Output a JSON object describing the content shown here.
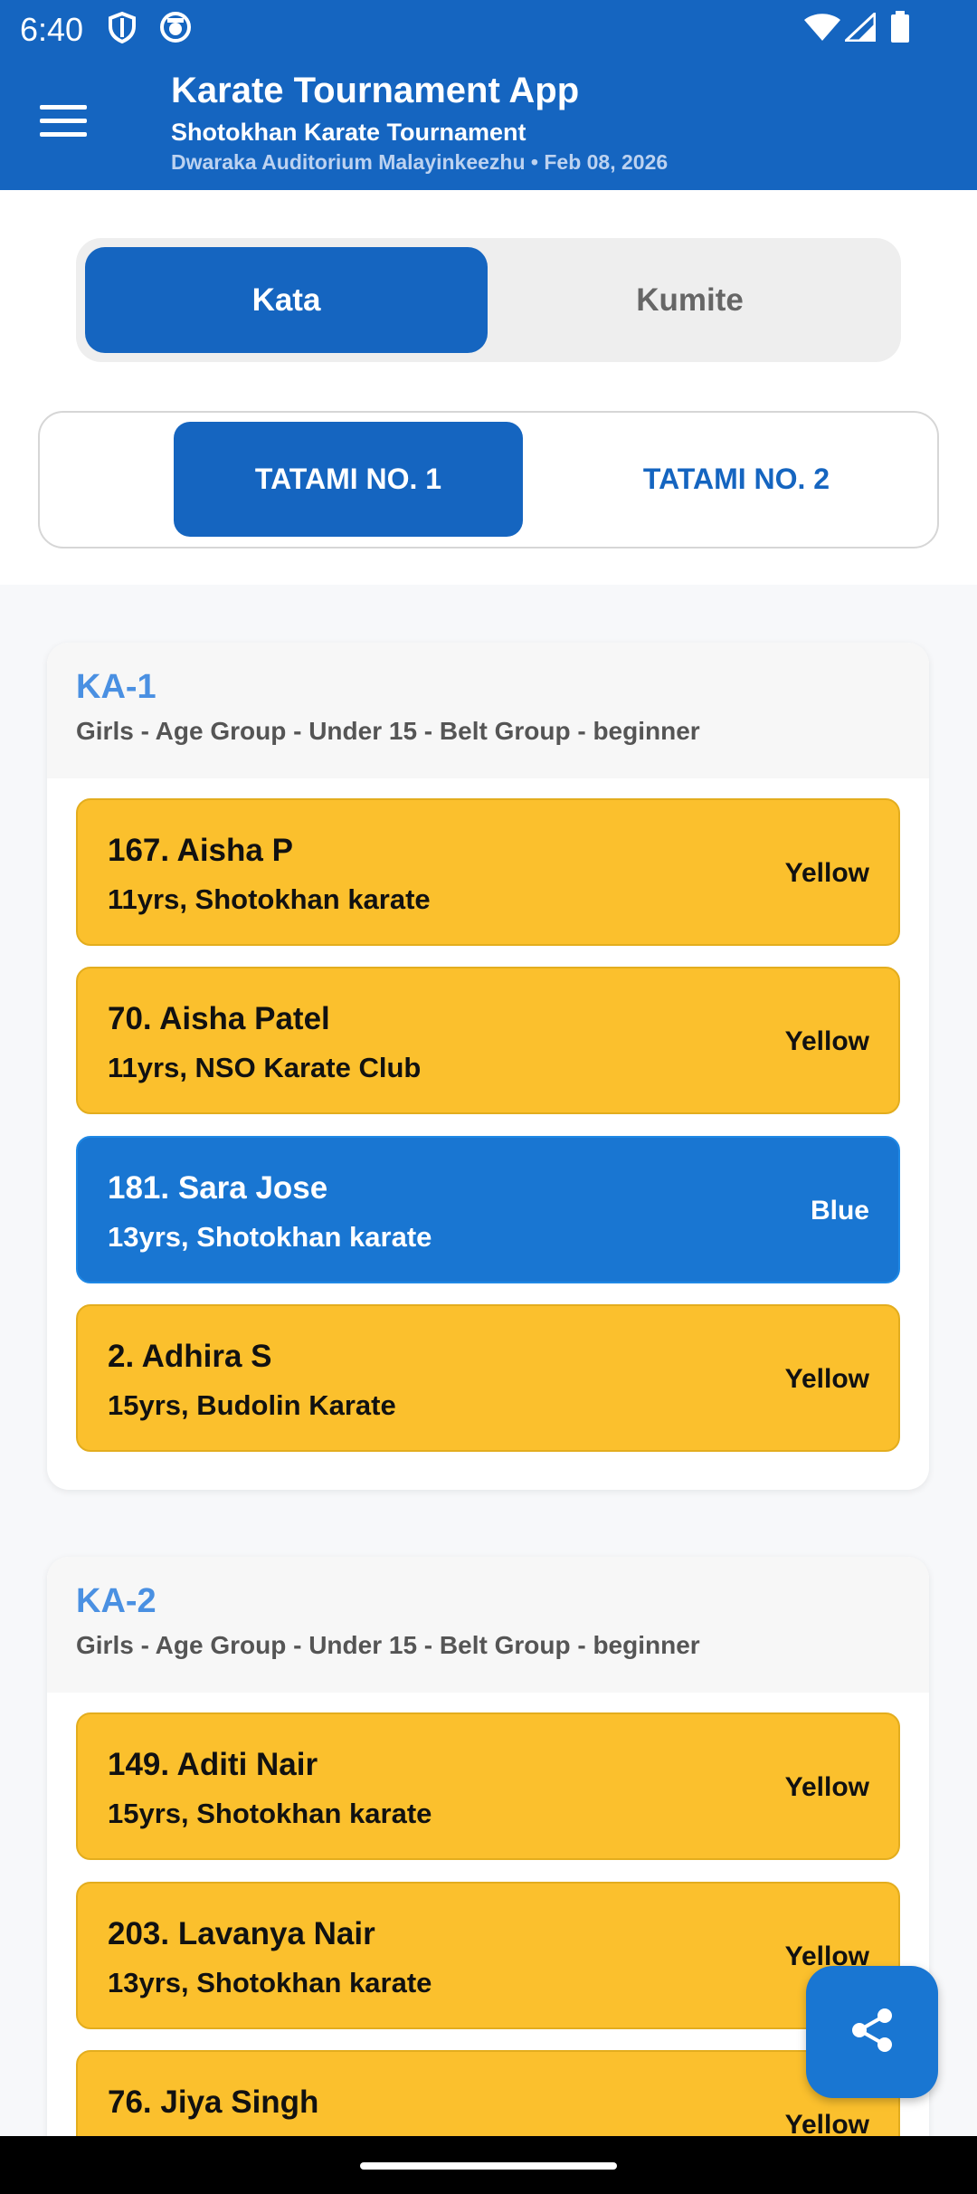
{
  "status_bar": {
    "time": "6:40"
  },
  "app_bar": {
    "title": "Karate Tournament App",
    "subtitle": "Shotokhan Karate Tournament",
    "venue_date": "Dwaraka Auditorium Malayinkeezhu • Feb 08, 2026"
  },
  "event_tabs": {
    "active": "Kata",
    "inactive": "Kumite"
  },
  "tatami_tabs": {
    "active": "TATAMI NO. 1",
    "inactive": "TATAMI NO. 2"
  },
  "categories": [
    {
      "code": "KA-1",
      "description": "Girls - Age Group - Under 15 - Belt Group - beginner",
      "players": [
        {
          "name": "167. Aisha P",
          "info": "11yrs, Shotokhan karate",
          "belt": "Yellow"
        },
        {
          "name": "70. Aisha Patel",
          "info": "11yrs, NSO Karate Club",
          "belt": "Yellow"
        },
        {
          "name": "181. Sara Jose",
          "info": "13yrs, Shotokhan karate",
          "belt": "Blue"
        },
        {
          "name": "2. Adhira S",
          "info": "15yrs, Budolin Karate",
          "belt": "Yellow"
        }
      ]
    },
    {
      "code": "KA-2",
      "description": "Girls - Age Group - Under 15 - Belt Group - beginner",
      "players": [
        {
          "name": "149. Aditi Nair",
          "info": "15yrs, Shotokhan karate",
          "belt": "Yellow"
        },
        {
          "name": "203. Lavanya Nair",
          "info": "13yrs, Shotokhan karate",
          "belt": "Yellow"
        },
        {
          "name": "76. Jiya Singh",
          "info": "",
          "belt": "Yellow"
        }
      ]
    }
  ],
  "colors": {
    "primary": "#1565c0",
    "yellow_belt": "#fbc02d",
    "blue_belt": "#1976d2",
    "category_code": "#4a90e2"
  },
  "icons": {
    "menu": "hamburger-icon",
    "share": "share-icon"
  }
}
